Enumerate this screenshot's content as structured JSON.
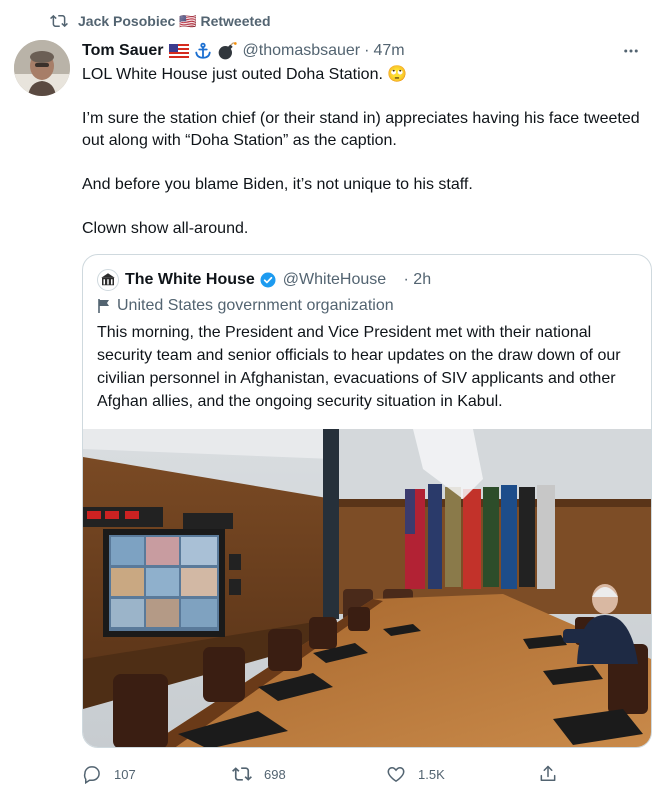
{
  "retweet_header": {
    "text": "Jack Posobiec 🇺🇸 Retweeted"
  },
  "tweet": {
    "display_name": "Tom Sauer",
    "handle": "@thomasbsauer",
    "separator": "·",
    "time": "47m",
    "paragraphs": [
      "LOL White House just outed Doha Station. 🙄",
      "I’m sure the station chief (or their stand in) appreciates having his face tweeted out along with “Doha Station” as the caption.",
      "And before you blame Biden, it’s not unique to his staff.",
      "Clown show all-around."
    ]
  },
  "quoted_tweet": {
    "display_name": "The White House",
    "handle": "@WhiteHouse",
    "separator": "·",
    "time": "2h",
    "label": "United States government organization",
    "text": "This morning, the President and Vice President met with their national security team and senior officials to hear updates on the draw down of our civilian personnel in Afghanistan, evacuations of SIV applicants and other Afghan allies, and the ongoing security situation in Kabul."
  },
  "actions": {
    "reply_count": "107",
    "retweet_count": "698",
    "like_count": "1.5K"
  },
  "icons": [
    "retweet-icon",
    "flag-us-icon",
    "anchor-icon",
    "bomb-icon",
    "more-icon",
    "verified-badge-icon",
    "government-flag-icon",
    "reply-icon",
    "like-icon",
    "share-icon"
  ],
  "colors": {
    "text": "#0f1419",
    "secondary": "#536471",
    "accent": "#1d9bf0",
    "border": "#cfd9de"
  }
}
